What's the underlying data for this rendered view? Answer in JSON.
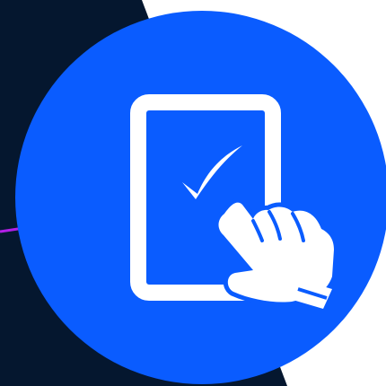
{
  "colors": {
    "background_dark": "#05172f",
    "background_light": "#ffffff",
    "badge_blue": "#0a5cff",
    "accent_purple": "#b21fe6",
    "icon_white": "#ffffff"
  },
  "icons": {
    "badge": "tablet-tap-checkmark-icon",
    "device": "tablet-icon",
    "check": "checkmark-icon",
    "hand": "pointing-hand-icon"
  }
}
